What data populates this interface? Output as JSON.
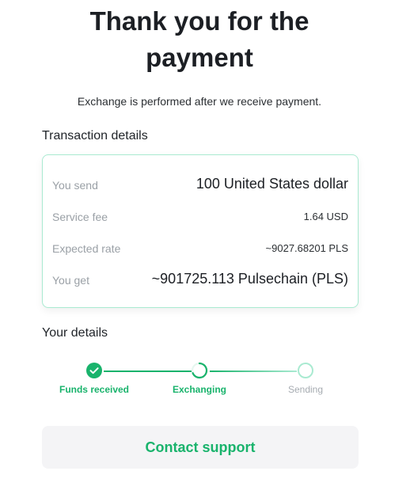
{
  "page": {
    "title_line1": "Thank you for the",
    "title_line2": "payment",
    "subtitle": "Exchange is performed after we receive payment."
  },
  "transaction": {
    "section_label": "Transaction details",
    "rows": [
      {
        "label": "You send",
        "value": "100 United States dollar"
      },
      {
        "label": "Service fee",
        "value": "1.64 USD"
      },
      {
        "label": "Expected rate",
        "value": "~9027.68201 PLS"
      },
      {
        "label": "You get",
        "value": "~901725.113 Pulsechain (PLS)"
      }
    ]
  },
  "details": {
    "section_label": "Your details",
    "steps": [
      {
        "label": "Funds received",
        "state": "done"
      },
      {
        "label": "Exchanging",
        "state": "in-progress"
      },
      {
        "label": "Sending",
        "state": "pending"
      }
    ]
  },
  "actions": {
    "support_label": "Contact support"
  },
  "colors": {
    "accent": "#19b36c",
    "accent_light": "#a9ead1",
    "muted": "#a6abb1"
  }
}
